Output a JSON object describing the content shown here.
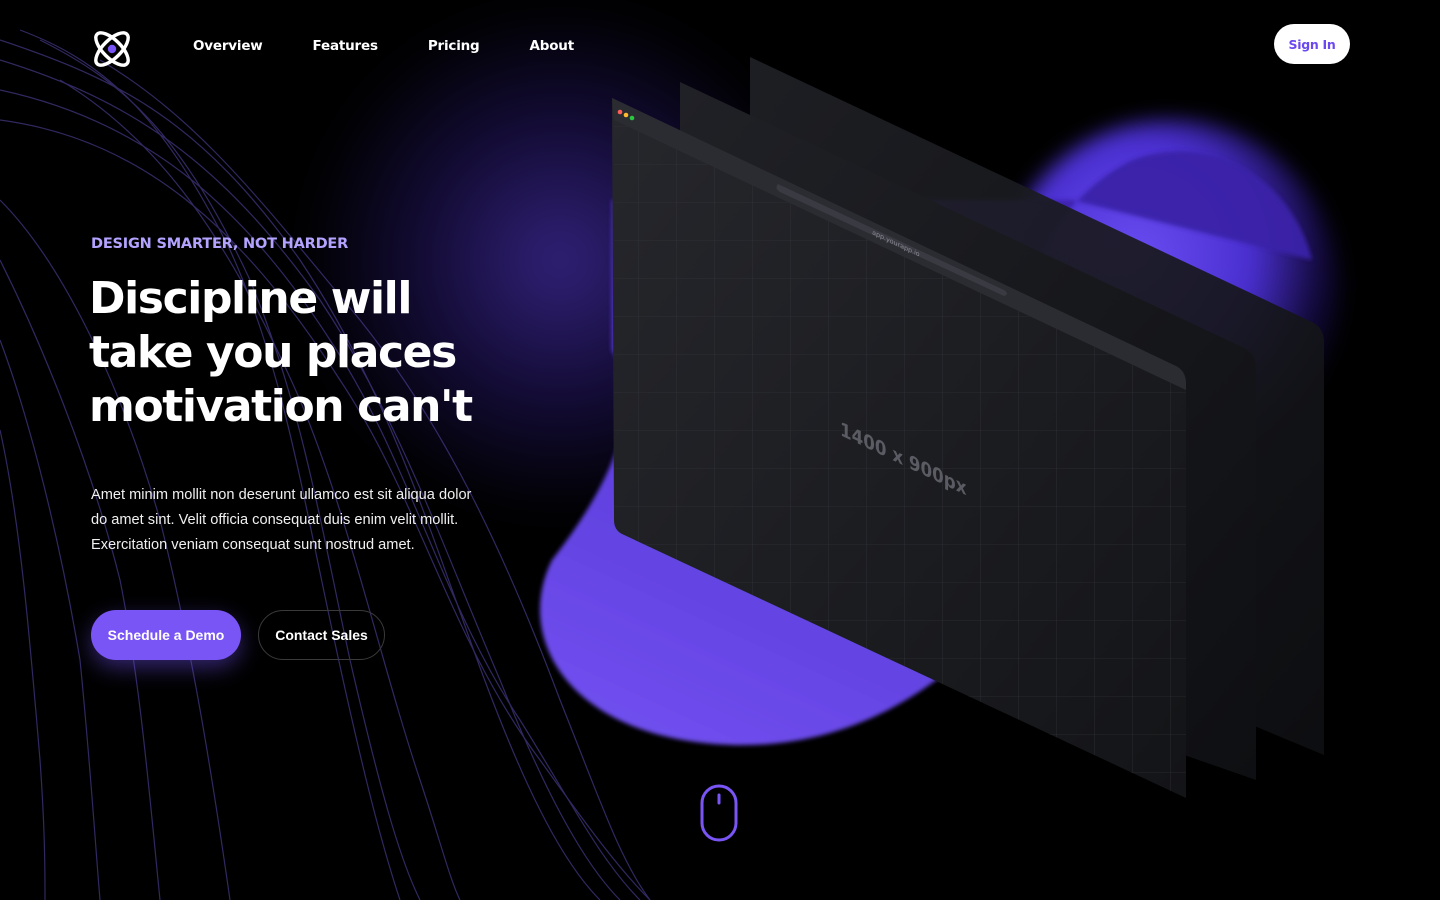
{
  "nav": {
    "items": [
      {
        "label": "Overview"
      },
      {
        "label": "Features"
      },
      {
        "label": "Pricing"
      },
      {
        "label": "About"
      }
    ],
    "signin_label": "Sign In"
  },
  "hero": {
    "eyebrow": "DESIGN SMARTER, NOT HARDER",
    "headline_lines": [
      "Discipline will",
      "take you places",
      "motivation can't"
    ],
    "description_lines": [
      "Amet minim mollit non deserunt ullamco est sit aliqua dolor",
      "do amet sint. Velit officia consequat duis enim velit mollit.",
      "Exercitation veniam consequat sunt nostrud amet."
    ],
    "primary_cta": "Schedule a Demo",
    "secondary_cta": "Contact Sales"
  },
  "mockup": {
    "url": "app.yourapp.io",
    "placeholder": "1400 x 900px"
  },
  "icons": {
    "logo": "atom-logo-icon",
    "scroll": "mouse-scroll-icon"
  },
  "colors": {
    "accent": "#7a55f6",
    "eyebrow": "#b3a3ff",
    "background": "#000000"
  }
}
